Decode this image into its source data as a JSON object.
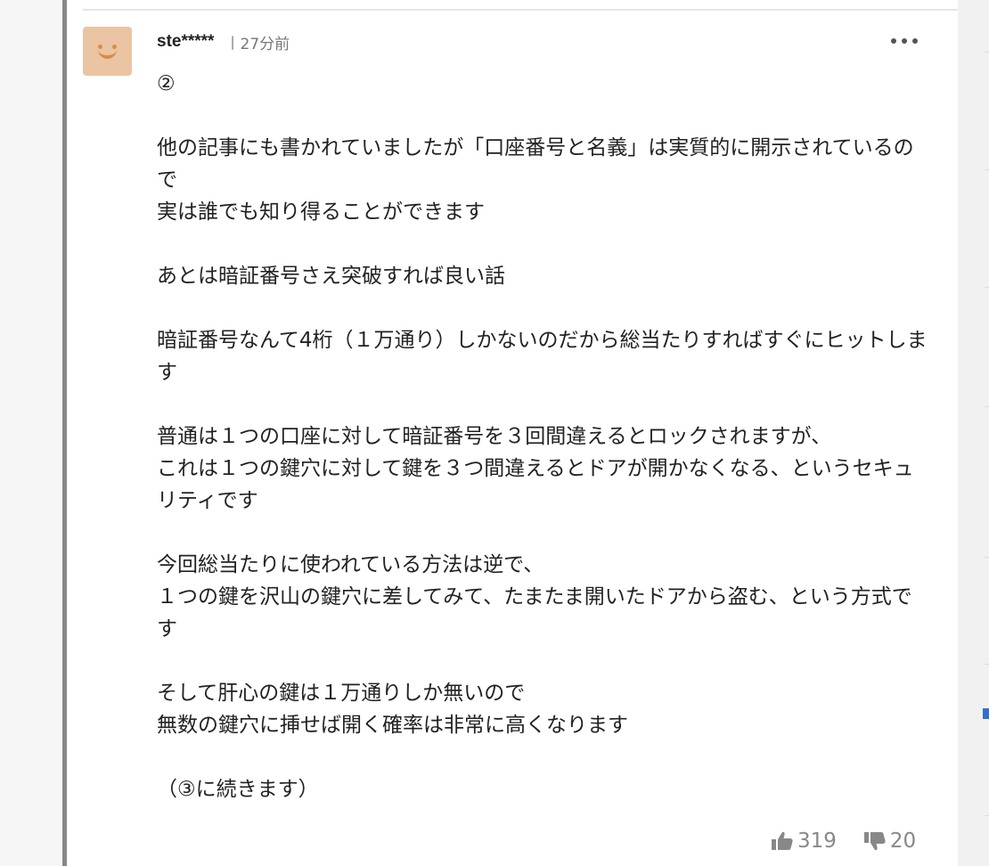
{
  "comment": {
    "username": "ste*****",
    "separator": "|",
    "time": "27分前",
    "body": "②\n\n他の記事にも書かれていましたが「口座番号と名義」は実質的に開示されているので\n実は誰でも知り得ることができます\n\nあとは暗証番号さえ突破すれば良い話\n\n暗証番号なんて4桁（１万通り）しかないのだから総当たりすればすぐにヒットします\n\n普通は１つの口座に対して暗証番号を３回間違えるとロックされますが、\nこれは１つの鍵穴に対して鍵を３つ間違えるとドアが開かなくなる、というセキュリティです\n\n今回総当たりに使われている方法は逆で、\n１つの鍵を沢山の鍵穴に差してみて、たまたま開いたドアから盗む、という方式です\n\nそして肝心の鍵は１万通りしか無いので\n無数の鍵穴に挿せば開く確率は非常に高くなります\n\n（③に続きます）",
    "likes": "319",
    "dislikes": "20"
  },
  "icons": {
    "avatar": "smiley-avatar",
    "more": "more-horizontal-icon",
    "like": "thumbs-up-icon",
    "dislike": "thumbs-down-icon"
  },
  "colors": {
    "avatar_bg": "#ebc4a3",
    "avatar_face": "#d98c47",
    "reaction_text": "#888888"
  }
}
